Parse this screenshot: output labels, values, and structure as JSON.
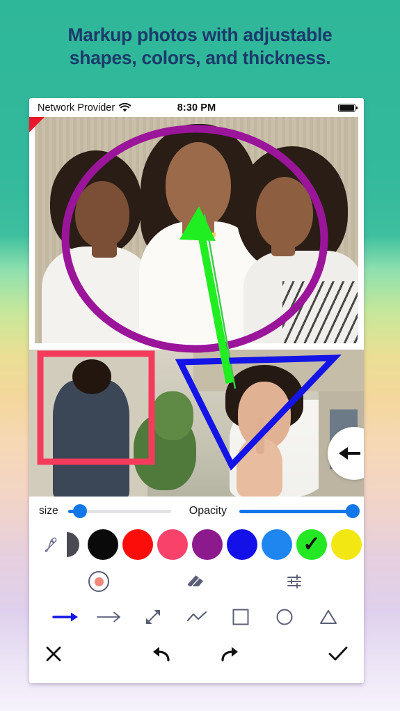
{
  "headline": {
    "line1": "Markup photos with adjustable",
    "line2": "shapes, colors, and thickness.",
    "color": "#1b3a6b"
  },
  "statusbar": {
    "carrier": "Network Provider",
    "wifi_icon": "wifi-icon",
    "time": "8:30 PM",
    "battery_icon": "battery-full-icon"
  },
  "canvas": {
    "corner_marker": "red-triangle-handle",
    "annotations": [
      {
        "name": "ellipse-annotation",
        "shape": "ellipse",
        "color": "#9b159b",
        "thickness": 11
      },
      {
        "name": "arrow-annotation",
        "shape": "arrow",
        "color": "#20ee20",
        "thickness": 10
      },
      {
        "name": "rectangle-annotation",
        "shape": "rectangle",
        "color": "#f43b5c",
        "thickness": 9
      },
      {
        "name": "triangle-annotation",
        "shape": "triangle",
        "color": "#1414e6",
        "thickness": 9
      },
      {
        "name": "line-annotation",
        "shape": "line",
        "color": "#3ecb4a",
        "thickness": 2
      }
    ]
  },
  "fab": {
    "label": "back-arrow",
    "icon": "arrow-left-icon"
  },
  "sliders": {
    "size": {
      "label": "size",
      "value": 12,
      "min": 0,
      "max": 100,
      "color": "#1177e8"
    },
    "opacity": {
      "label": "Opacity",
      "value": 100,
      "min": 0,
      "max": 100,
      "color": "#1177e8"
    }
  },
  "colors": {
    "eyedropper_icon": "eyedropper-icon",
    "gradient_swatch": "half-circle-shade-swatch",
    "swatches": [
      {
        "name": "black",
        "hex": "#0a0a0a",
        "selected": false
      },
      {
        "name": "red",
        "hex": "#fb0d09",
        "selected": false
      },
      {
        "name": "pink",
        "hex": "#f8426a",
        "selected": false
      },
      {
        "name": "purple",
        "hex": "#8d1a8d",
        "selected": false
      },
      {
        "name": "blue",
        "hex": "#1411e8",
        "selected": false
      },
      {
        "name": "light-blue",
        "hex": "#1f86ef",
        "selected": false
      },
      {
        "name": "green",
        "hex": "#24e824",
        "selected": true
      },
      {
        "name": "yellow",
        "hex": "#f2e712",
        "selected": false
      }
    ],
    "selected_check": "✓"
  },
  "tools": [
    {
      "name": "brush-color-tool",
      "icon": "circle-dot-icon",
      "dot_color": "#f2877a"
    },
    {
      "name": "eraser-tool",
      "icon": "eraser-icon"
    },
    {
      "name": "adjust-settings-tool",
      "icon": "sliders-icon"
    }
  ],
  "shapes": [
    {
      "name": "arrow-thick-tool",
      "icon": "arrow-right-bold-icon",
      "selected": true
    },
    {
      "name": "arrow-thin-tool",
      "icon": "arrow-right-thin-icon",
      "selected": false
    },
    {
      "name": "double-arrow-tool",
      "icon": "arrows-diagonal-icon",
      "selected": false
    },
    {
      "name": "zigzag-line-tool",
      "icon": "zigzag-line-icon",
      "selected": false
    },
    {
      "name": "square-tool",
      "icon": "square-icon",
      "selected": false
    },
    {
      "name": "circle-tool",
      "icon": "circle-icon",
      "selected": false
    },
    {
      "name": "triangle-tool",
      "icon": "triangle-icon",
      "selected": false
    }
  ],
  "actions": {
    "cancel": {
      "name": "cancel-button",
      "icon": "close-x-icon"
    },
    "undo": {
      "name": "undo-button",
      "icon": "undo-arrow-icon"
    },
    "redo": {
      "name": "redo-button",
      "icon": "redo-arrow-icon"
    },
    "confirm": {
      "name": "confirm-button",
      "icon": "check-icon"
    }
  }
}
